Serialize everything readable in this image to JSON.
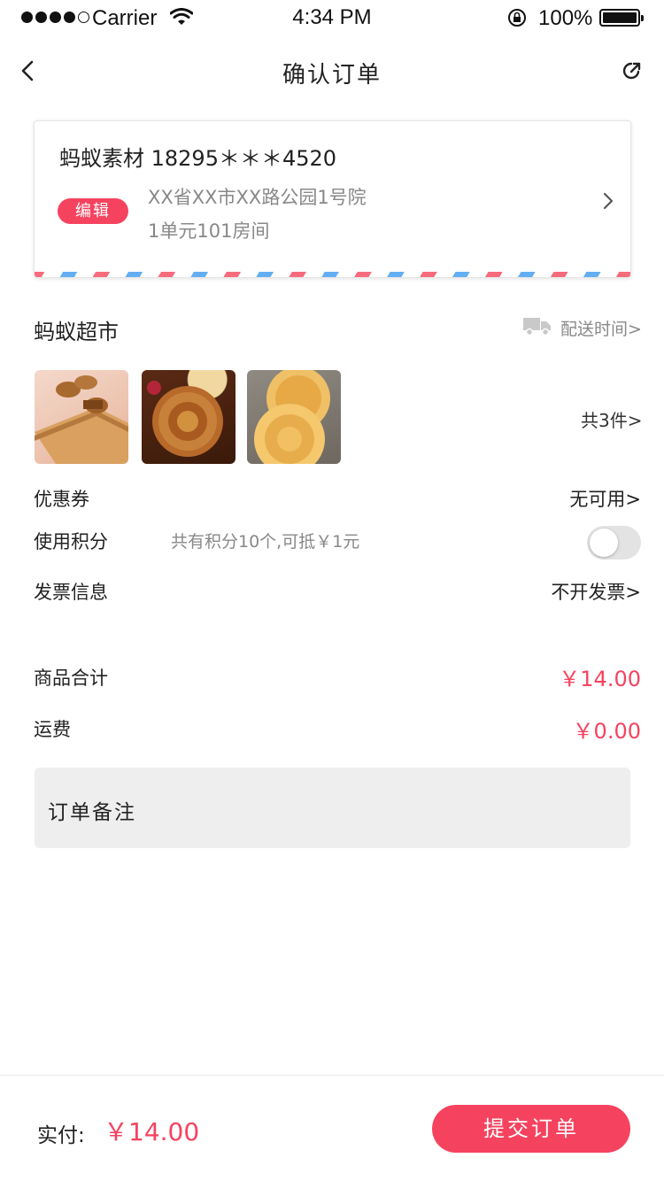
{
  "status_bar": {
    "carrier": "Carrier",
    "time": "4:34 PM",
    "battery": "100%",
    "signal_icon": "signal-dots-icon",
    "wifi_icon": "wifi-icon",
    "lock_icon": "rotation-lock-icon",
    "battery_icon": "battery-icon"
  },
  "nav": {
    "title": "确认订单",
    "back_icon": "back-arrow-icon",
    "share_icon": "share-icon"
  },
  "address": {
    "name_phone": "蚂蚁素材 18295＊＊＊4520",
    "edit_label": "编辑",
    "line1": "XX省XX市XX路公园1号院",
    "line2": "1单元101房间",
    "arrow_icon": "chevron-right-icon"
  },
  "store": {
    "name": "蚂蚁超市",
    "truck_icon": "delivery-truck-icon",
    "delivery_time": "配送时间>",
    "products": [
      "mooncake-product-1",
      "mooncake-product-2",
      "mooncake-product-3"
    ],
    "total_count": "共3件>"
  },
  "options": {
    "coupon_label": "优惠券",
    "coupon_value": "无可用>",
    "points_label": "使用积分",
    "points_desc": "共有积分10个,可抵￥1元",
    "points_toggle_on": false,
    "invoice_label": "发票信息",
    "invoice_value": "不开发票>"
  },
  "summary": {
    "subtotal_label": "商品合计",
    "subtotal_value": "￥14.00",
    "shipping_label": "运费",
    "shipping_value": "￥0.00"
  },
  "remark": {
    "label": "订单备注"
  },
  "bottom": {
    "pay_label": "实付:",
    "pay_amount": "￥14.00",
    "submit_label": "提交订单"
  },
  "colors": {
    "accent": "#f5435f",
    "remark_bg": "#eeeeee",
    "airmail_red": "#f76b7c",
    "airmail_blue": "#63aef3"
  }
}
